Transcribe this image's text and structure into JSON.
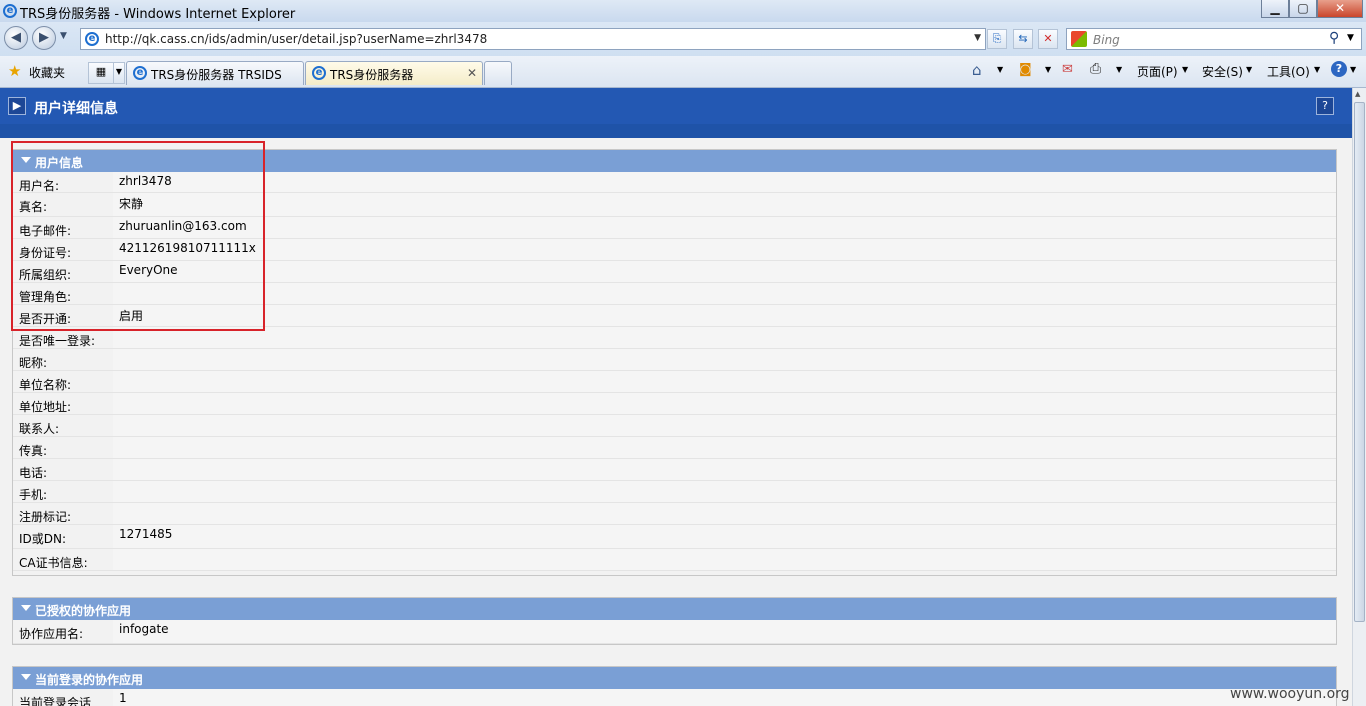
{
  "window": {
    "title": "TRS身份服务器 - Windows Internet Explorer",
    "minimize_label": "▁",
    "maximize_label": "▢",
    "close_label": "✕"
  },
  "address_bar": {
    "url": "http://qk.cass.cn/ids/admin/user/detail.jsp?userName=zhrl3478"
  },
  "search": {
    "placeholder": "Bing"
  },
  "tabs": [
    {
      "label": "TRS身份服务器 TRSIDS"
    },
    {
      "label": "TRS身份服务器"
    }
  ],
  "favorites_label": "收藏夹",
  "commands": {
    "page": "页面(P)",
    "safety": "安全(S)",
    "tools": "工具(O)"
  },
  "page": {
    "title": "用户详细信息",
    "help_label": "?"
  },
  "user_info": {
    "heading": "用户信息",
    "rows": [
      {
        "label": "用户名:",
        "value": "zhrl3478"
      },
      {
        "label": "真名:",
        "value": "宋静"
      },
      {
        "label": "电子邮件:",
        "value": "zhuruanlin@163.com"
      },
      {
        "label": "身份证号:",
        "value": "42112619810711111x"
      },
      {
        "label": "所属组织:",
        "value": "EveryOne"
      },
      {
        "label": "管理角色:",
        "value": ""
      },
      {
        "label": "是否开通:",
        "value": "启用"
      },
      {
        "label": "是否唯一登录:",
        "value": ""
      },
      {
        "label": "昵称:",
        "value": ""
      },
      {
        "label": "单位名称:",
        "value": ""
      },
      {
        "label": "单位地址:",
        "value": ""
      },
      {
        "label": "联系人:",
        "value": ""
      },
      {
        "label": "传真:",
        "value": ""
      },
      {
        "label": "电话:",
        "value": ""
      },
      {
        "label": "手机:",
        "value": ""
      },
      {
        "label": "注册标记:",
        "value": ""
      },
      {
        "label": "ID或DN:",
        "value": "1271485"
      },
      {
        "label": "CA证书信息:",
        "value": ""
      }
    ]
  },
  "authorized_apps": {
    "heading": "已授权的协作应用",
    "rows": [
      {
        "label": "协作应用名:",
        "value": "infogate"
      }
    ]
  },
  "current_apps": {
    "heading": "当前登录的协作应用",
    "rows": [
      {
        "label": "当前登录会话",
        "value": "1"
      }
    ]
  },
  "watermark": "www.wooyun.org",
  "colors": {
    "header_blue": "#2358b3",
    "section_blue": "#7a9fd5",
    "highlight_red": "#d8232a"
  }
}
